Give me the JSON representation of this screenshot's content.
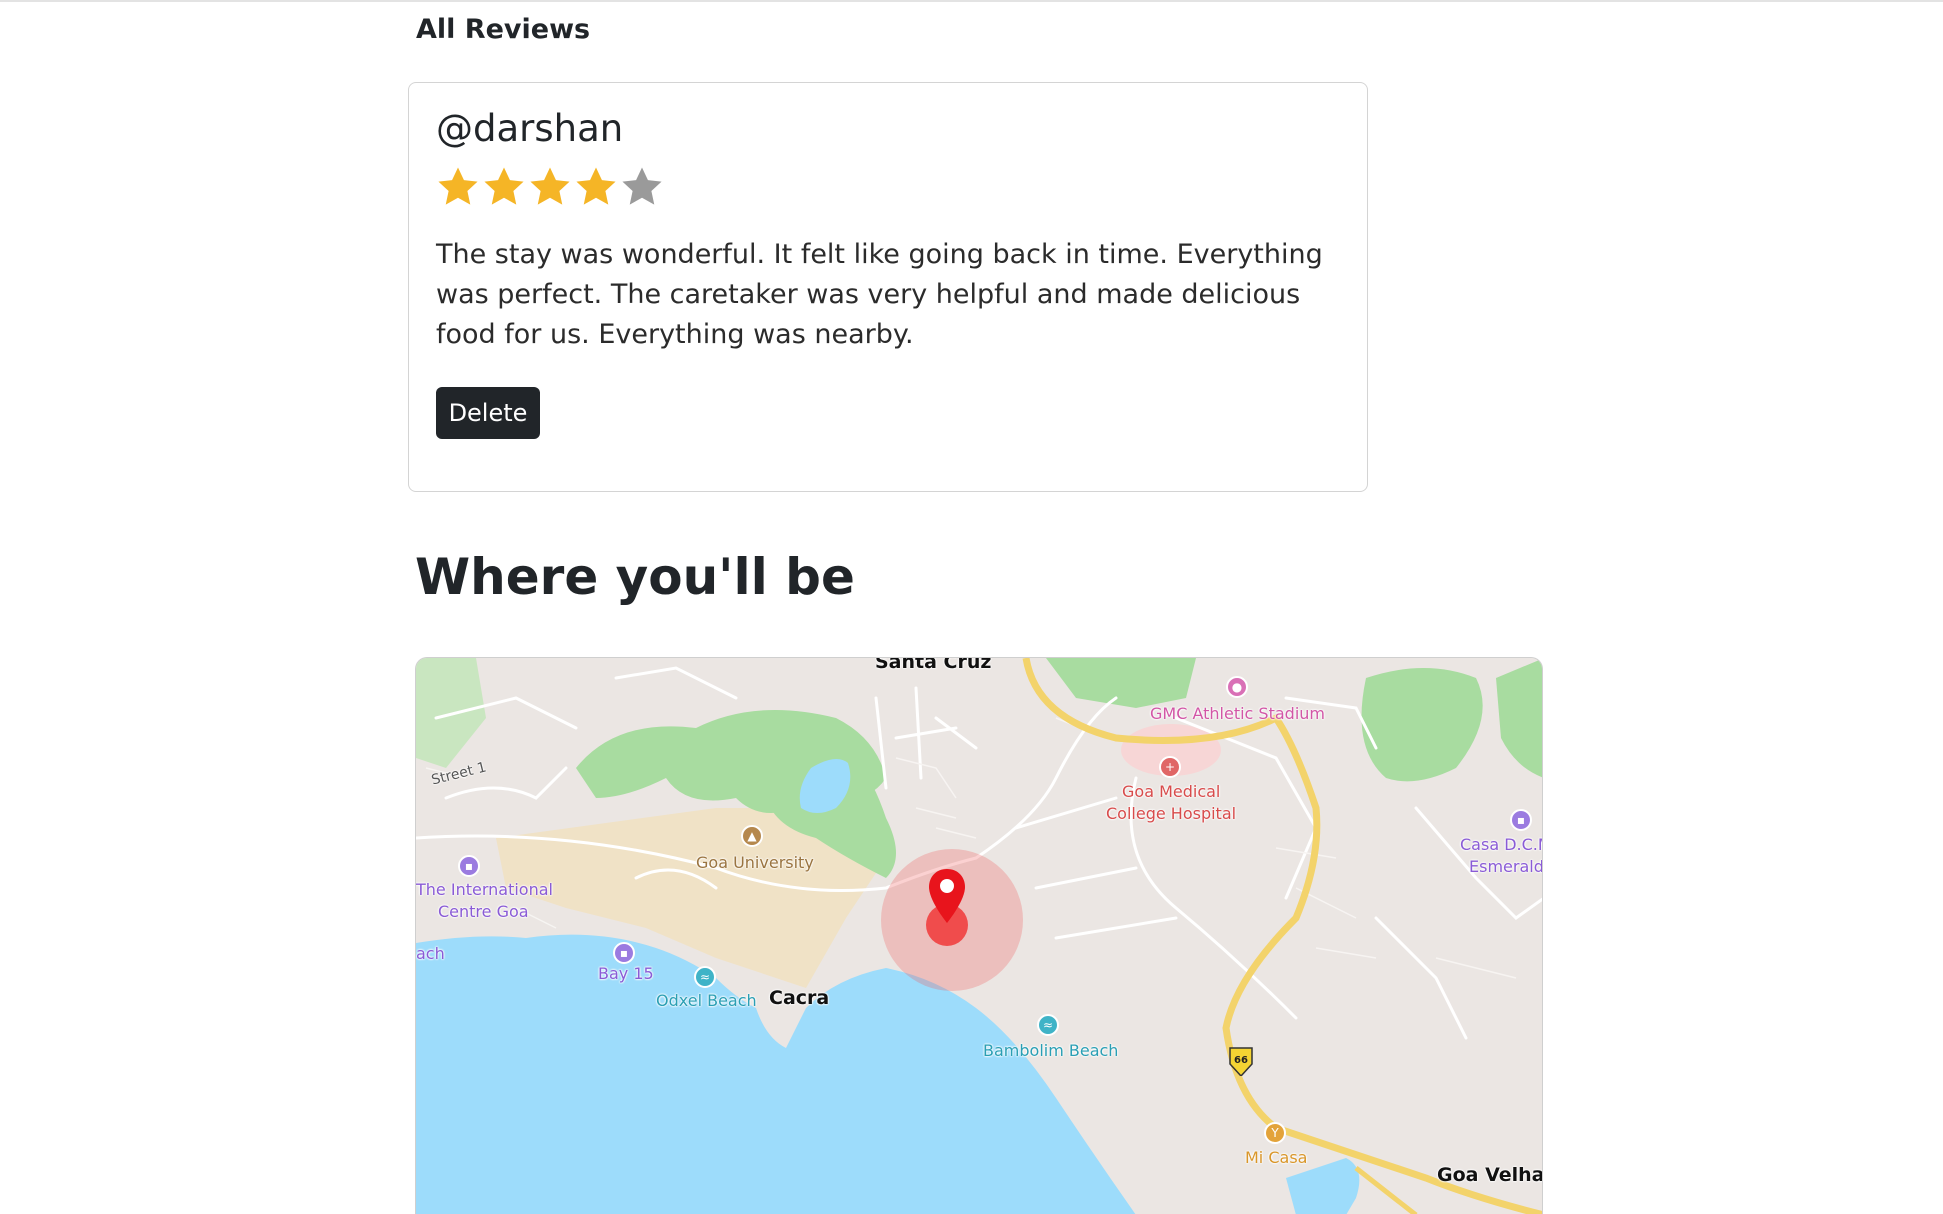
{
  "reviews": {
    "heading": "All Reviews",
    "items": [
      {
        "author": "@darshan",
        "rating": 4,
        "max_rating": 5,
        "text": "The stay was wonderful. It felt like going back in time. Everything was perfect. The caretaker was very helpful and made delicious food for us. Everything was nearby.",
        "delete_label": "Delete"
      }
    ]
  },
  "location": {
    "heading": "Where you'll be",
    "map": {
      "labels": {
        "santa_cruz": "Santa Cruz",
        "street1": "Street 1",
        "gmc_stadium": "GMC Athletic Stadium",
        "goa_medical_1": "Goa Medical",
        "goa_medical_2": "College Hospital",
        "goa_university": "Goa University",
        "casa_1": "Casa D.C.M",
        "casa_2": "Esmerald",
        "intl_centre_1": "The International",
        "intl_centre_2": "Centre Goa",
        "beach_partial": "ach",
        "bay15": "Bay 15",
        "odxel_beach": "Odxel Beach",
        "cacra": "Cacra",
        "bambolim_beach": "Bambolim Beach",
        "highway_66": "66",
        "mi_casa": "Mi Casa",
        "goa_velha": "Goa Velha"
      },
      "colors": {
        "land": "#ebe6e3",
        "water": "#9ddcfb",
        "park": "#a8dca0",
        "campus": "#f0e2c6",
        "highway": "#f3d36b",
        "pin": "#e8141c"
      },
      "icons": [
        "hotel-icon",
        "beach-icon",
        "university-icon",
        "stadium-icon",
        "hospital-icon",
        "restaurant-icon",
        "location-pin-icon",
        "highway-shield-icon"
      ]
    }
  }
}
